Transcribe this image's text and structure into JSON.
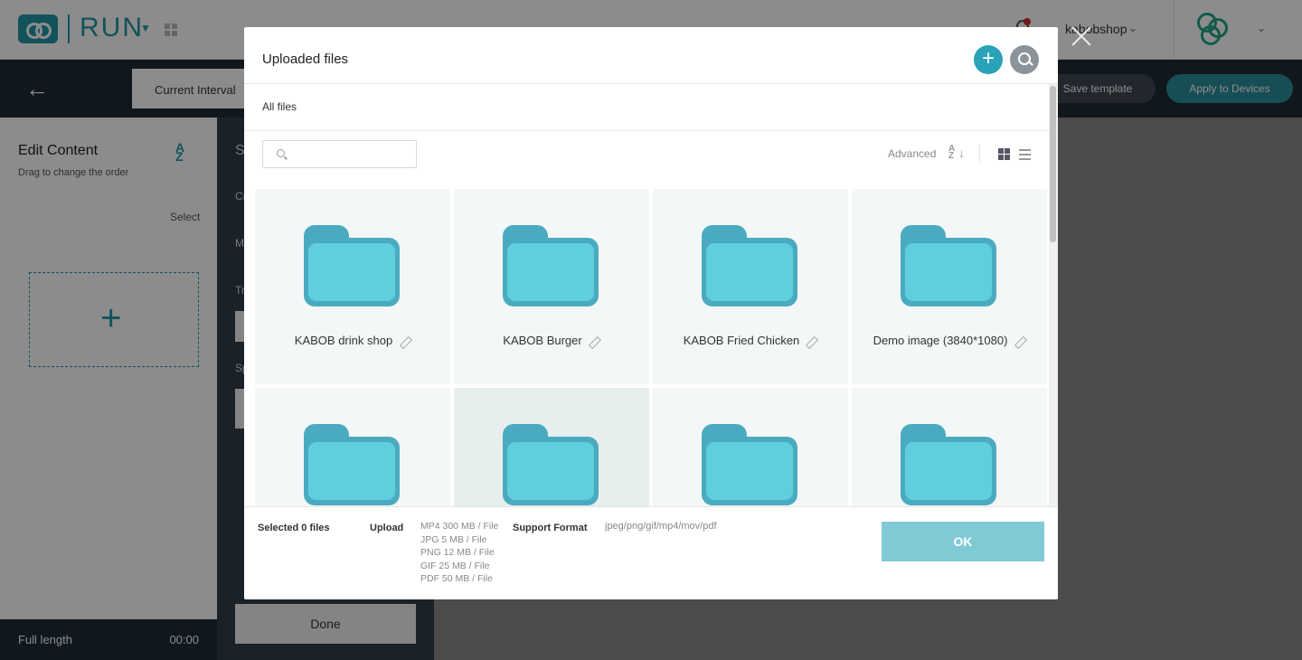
{
  "app": {
    "logo_text": "RUN",
    "account_name": "kabobshop",
    "current_interval_label": "Current Interval",
    "save_template_label": "Save template",
    "apply_devices_label": "Apply to Devices",
    "edit_content_title": "Edit Content",
    "edit_content_sub": "Drag to change the order",
    "select_label": "Select",
    "full_length_label": "Full length",
    "full_length_value": "00:00",
    "done_label": "Done",
    "mid_letters": [
      "S",
      "Cr",
      "M",
      "Tr",
      "Sp"
    ]
  },
  "modal": {
    "title": "Uploaded files",
    "breadcrumb": "All files",
    "search_placeholder": "",
    "advanced_label": "Advanced",
    "sort_icon_text": "A\nZ",
    "files": [
      {
        "name": "KABOB drink shop"
      },
      {
        "name": "KABOB Burger"
      },
      {
        "name": "KABOB Fried Chicken"
      },
      {
        "name": "Demo image (3840*1080)"
      },
      {
        "name": ""
      },
      {
        "name": ""
      },
      {
        "name": ""
      },
      {
        "name": ""
      }
    ],
    "footer": {
      "selected_label": "Selected 0 files",
      "upload_label": "Upload",
      "limits": [
        "MP4 300 MB / File",
        "JPG 5 MB / File",
        "PNG 12 MB / File",
        "GIF 25 MB / File",
        "PDF 50 MB / File"
      ],
      "support_format_label": "Support Format",
      "support_format_value": "jpeg/png/gif/mp4/mov/pdf",
      "ok_label": "OK"
    }
  },
  "colors": {
    "accent": "#2aa2b8",
    "folder_dark": "#4aabc0",
    "folder_light": "#5fcfde",
    "ok_button": "#80cad6",
    "header_dark": "#1e2a35"
  }
}
